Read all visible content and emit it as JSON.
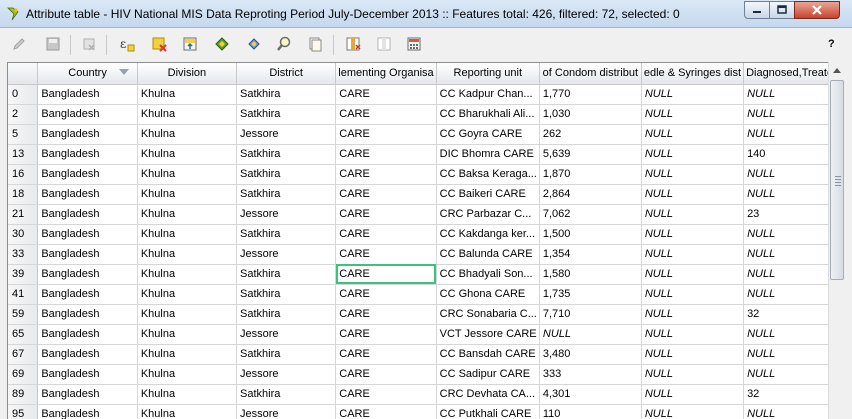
{
  "window": {
    "title": "Attribute table - HIV National MIS Data Reproting Period July-December 2013 :: Features total: 426, filtered: 72, selected: 0"
  },
  "toolbar": {
    "icons": [
      "pencil-edit-icon",
      "save-edits-icon",
      "delete-selected-icon",
      "expression-select-icon",
      "deselect-all-icon",
      "move-selection-to-top-icon",
      "invert-selection-icon",
      "pan-map-to-selected-icon",
      "zoom-map-to-selected-icon",
      "copy-rows-icon",
      "new-column-icon",
      "delete-column-icon",
      "field-calculator-icon"
    ],
    "help_label": "?"
  },
  "table": {
    "columns": [
      "Country",
      "Division",
      "District",
      "lementing Organisa",
      "Reporting unit",
      "of Condom distribut",
      "edle & Syringes dist",
      "Diagnosed,Treate"
    ],
    "rows": [
      {
        "id": "0",
        "cells": [
          "Bangladesh",
          "Khulna",
          "Satkhira",
          "CARE",
          "CC Kadpur Chan...",
          "1,770",
          "NULL",
          "NULL"
        ]
      },
      {
        "id": "2",
        "cells": [
          "Bangladesh",
          "Khulna",
          "Satkhira",
          "CARE",
          "CC Bharukhali Ali...",
          "1,030",
          "NULL",
          "NULL"
        ]
      },
      {
        "id": "5",
        "cells": [
          "Bangladesh",
          "Khulna",
          "Jessore",
          "CARE",
          "CC Goyra CARE",
          "262",
          "NULL",
          "NULL"
        ]
      },
      {
        "id": "13",
        "cells": [
          "Bangladesh",
          "Khulna",
          "Satkhira",
          "CARE",
          "DIC Bhomra CARE",
          "5,639",
          "NULL",
          "140"
        ]
      },
      {
        "id": "16",
        "cells": [
          "Bangladesh",
          "Khulna",
          "Satkhira",
          "CARE",
          "CC Baksa Keraga...",
          "1,870",
          "NULL",
          "NULL"
        ]
      },
      {
        "id": "18",
        "cells": [
          "Bangladesh",
          "Khulna",
          "Satkhira",
          "CARE",
          "CC Baikeri CARE",
          "2,864",
          "NULL",
          "NULL"
        ]
      },
      {
        "id": "21",
        "cells": [
          "Bangladesh",
          "Khulna",
          "Jessore",
          "CARE",
          "CRC Parbazar C...",
          "7,062",
          "NULL",
          "23"
        ]
      },
      {
        "id": "30",
        "cells": [
          "Bangladesh",
          "Khulna",
          "Satkhira",
          "CARE",
          "CC Kakdanga ker...",
          "1,500",
          "NULL",
          "NULL"
        ]
      },
      {
        "id": "33",
        "cells": [
          "Bangladesh",
          "Khulna",
          "Jessore",
          "CARE",
          "CC Balunda CARE",
          "1,354",
          "NULL",
          "NULL"
        ]
      },
      {
        "id": "39",
        "cells": [
          "Bangladesh",
          "Khulna",
          "Satkhira",
          "CARE",
          "CC Bhadyali Son...",
          "1,580",
          "NULL",
          "NULL"
        ]
      },
      {
        "id": "41",
        "cells": [
          "Bangladesh",
          "Khulna",
          "Satkhira",
          "CARE",
          "CC Ghona CARE",
          "1,735",
          "NULL",
          "NULL"
        ]
      },
      {
        "id": "59",
        "cells": [
          "Bangladesh",
          "Khulna",
          "Satkhira",
          "CARE",
          "CRC Sonabaria C...",
          "7,710",
          "NULL",
          "32"
        ]
      },
      {
        "id": "65",
        "cells": [
          "Bangladesh",
          "Khulna",
          "Jessore",
          "CARE",
          "VCT Jessore CARE",
          "NULL",
          "NULL",
          "NULL"
        ]
      },
      {
        "id": "67",
        "cells": [
          "Bangladesh",
          "Khulna",
          "Satkhira",
          "CARE",
          "CC Bansdah CARE",
          "3,480",
          "NULL",
          "NULL"
        ]
      },
      {
        "id": "69",
        "cells": [
          "Bangladesh",
          "Khulna",
          "Jessore",
          "CARE",
          "CC Sadipur CARE",
          "333",
          "NULL",
          "NULL"
        ]
      },
      {
        "id": "89",
        "cells": [
          "Bangladesh",
          "Khulna",
          "Satkhira",
          "CARE",
          "CRC Devhata CA...",
          "4,301",
          "NULL",
          "32"
        ]
      },
      {
        "id": "95",
        "cells": [
          "Bangladesh",
          "Khulna",
          "Jessore",
          "CARE",
          "CC Putkhali CARE",
          "110",
          "NULL",
          "NULL"
        ]
      }
    ],
    "selected_cell": {
      "row": 9,
      "col": 3
    }
  },
  "colors": {
    "selection_outline": "#3cc27d",
    "null_text": "#8a8a8a",
    "close_button": "#c7442c"
  }
}
